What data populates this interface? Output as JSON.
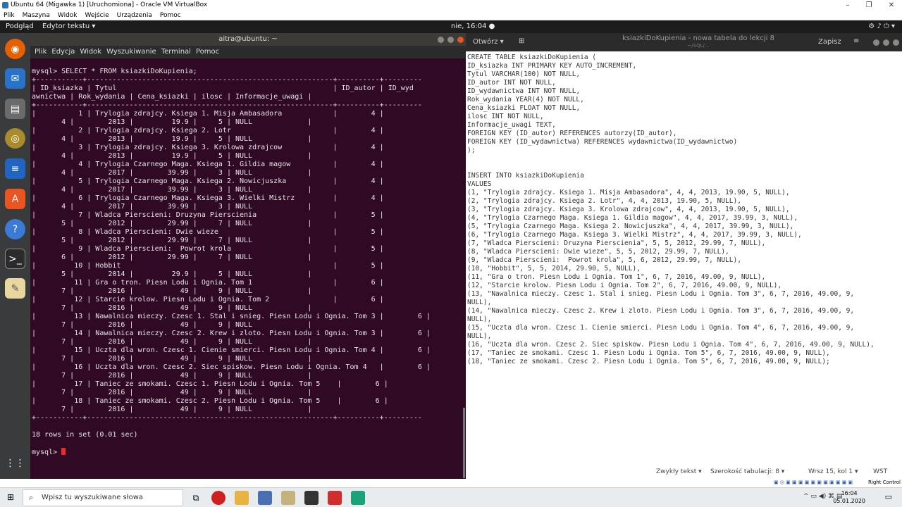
{
  "vbox": {
    "title": "Ubuntu 64 (Migawka 1) [Uruchomiona] - Oracle VM VirtualBox",
    "menu": [
      "Plik",
      "Maszyna",
      "Widok",
      "Wejście",
      "Urządzenia",
      "Pomoc"
    ],
    "status_right": "Right Control"
  },
  "gnome": {
    "activities": "Podgląd",
    "app": "Edytor tekstu ▾",
    "clock": "nie, 16:04 ●"
  },
  "terminal": {
    "title": "aitra@ubuntu: ~",
    "menu": [
      "Plik",
      "Edycja",
      "Widok",
      "Wyszukiwanie",
      "Terminal",
      "Pomoc"
    ],
    "lines": [
      "mysql> SELECT * FROM ksiazkiDoKupienia;",
      "+-----------+----------------------------------------------------------+----------+---------",
      "| ID_ksiazka | Tytul                                                   | ID_autor | ID_wyd",
      "awnictwa | Rok_wydania | Cena_ksiazki | ilosc | Informacje_uwagi |",
      "+-----------+----------------------------------------------------------+----------+---------",
      "|          1 | Trylogia zdrajcy. Ksiega 1. Misja Ambasadora            |        4 |",
      "       4 |        2013 |         19.9 |     5 | NULL             |",
      "|          2 | Trylogia zdrajcy. Ksiega 2. Lotr                        |        4 |",
      "       4 |        2013 |         19.9 |     5 | NULL             |",
      "|          3 | Trylogia zdrajcy. Ksiega 3. Krolowa zdrajcow            |        4 |",
      "       4 |        2013 |         19.9 |     5 | NULL             |",
      "|          4 | Trylogia Czarnego Maga. Ksiega 1. Gildia magow          |        4 |",
      "       4 |        2017 |        39.99 |     3 | NULL             |",
      "|          5 | Trylogia Czarnego Maga. Ksiega 2. Nowicjuszka           |        4 |",
      "       4 |        2017 |        39.99 |     3 | NULL             |",
      "|          6 | Trylogia Czarnego Maga. Ksiega 3. Wielki Mistrz         |        4 |",
      "       4 |        2017 |        39.99 |     3 | NULL             |",
      "|          7 | Wladca Pierscieni: Druzyna Pierscienia                  |        5 |",
      "       5 |        2012 |        29.99 |     7 | NULL             |",
      "|          8 | Wladca Pierscieni: Dwie wieze                           |        5 |",
      "       5 |        2012 |        29.99 |     7 | NULL             |",
      "|          9 | Wladca Pierscieni:  Powrot krola                        |        5 |",
      "       6 |        2012 |        29.99 |     7 | NULL             |",
      "|         10 | Hobbit                                                  |        5 |",
      "       5 |        2014 |         29.9 |     5 | NULL             |",
      "|         11 | Gra o tron. Piesn Lodu i Ognia. Tom 1                   |        6 |",
      "       7 |        2016 |           49 |     9 | NULL             |",
      "|         12 | Starcie krolow. Piesn Lodu i Ognia. Tom 2               |        6 |",
      "       7 |        2016 |           49 |     9 | NULL             |",
      "|         13 | Nawalnica mieczy. Czesc 1. Stal i snieg. Piesn Lodu i Ognia. Tom 3 |        6 |",
      "       7 |        2016 |           49 |     9 | NULL             |",
      "|         14 | Nawalnica mieczy. Czesc 2. Krew i zloto. Piesn Lodu i Ognia. Tom 3 |        6 |",
      "       7 |        2016 |           49 |     9 | NULL             |",
      "|         15 | Uczta dla wron. Czesc 1. Cienie smierci. Piesn Lodu i Ognia. Tom 4 |        6 |",
      "       7 |        2016 |           49 |     9 | NULL             |",
      "|         16 | Uczta dla wron. Czesc 2. Siec spiskow. Piesn Lodu i Ognia. Tom 4   |        6 |",
      "       7 |        2016 |           49 |     9 | NULL             |",
      "|         17 | Taniec ze smokami. Czesc 1. Piesn Lodu i Ognia. Tom 5    |        6 |",
      "       7 |        2016 |           49 |     9 | NULL             |",
      "|         18 | Taniec ze smokami. Czesc 2. Piesn Lodu i Ognia. Tom 5    |        6 |",
      "       7 |        2016 |           49 |     9 | NULL             |",
      "+-----------+----------------------------------------------------------+----------+---------",
      "",
      "18 rows in set (0.01 sec)",
      ""
    ],
    "prompt": "mysql> "
  },
  "gedit": {
    "open": "Otwórz ▾",
    "save": "Zapisz",
    "title": "ksiazkiDoKupienia - nowa tabela do lekcji 8",
    "subtitle": "~/SQL/...",
    "lines": [
      "CREATE TABLE ksiazkiDoKupienia (",
      "ID_ksiazka INT PRIMARY KEY AUTO_INCREMENT,",
      "Tytul VARCHAR(100) NOT NULL,",
      "ID_autor INT NOT NULL,",
      "ID_wydawnictwa INT NOT NULL,",
      "Rok_wydania YEAR(4) NOT NULL,",
      "Cena_ksiazki FLOAT NOT NULL,",
      "ilosc INT NOT NULL,",
      "Informacje_uwagi TEXT,",
      "FOREIGN KEY (ID_autor) REFERENCES autorzy(ID_autor),",
      "FOREIGN KEY (ID_wydawnictwa) REFERENCES wydawnictwa(ID_wydawnictwo)",
      ");",
      "",
      "",
      "INSERT INTO ksiazkiDoKupienia",
      "VALUES",
      "(1, \"Trylogia zdrajcy. Ksiega 1. Misja Ambasadora\", 4, 4, 2013, 19.90, 5, NULL),",
      "(2, \"Trylogia zdrajcy. Ksiega 2. Lotr\", 4, 4, 2013, 19.90, 5, NULL),",
      "(3, \"Trylogia zdrajcy. Ksiega 3. Krolowa zdrajcow\", 4, 4, 2013, 19.90, 5, NULL),",
      "(4, \"Trylogia Czarnego Maga. Ksiega 1. Gildia magow\", 4, 4, 2017, 39.99, 3, NULL),",
      "(5, \"Trylogia Czarnego Maga. Ksiega 2. Nowicjuszka\", 4, 4, 2017, 39.99, 3, NULL),",
      "(6, \"Trylogia Czarnego Maga. Ksiega 3. Wielki Mistrz\", 4, 4, 2017, 39.99, 3, NULL),",
      "(7, \"Wladca Pierscieni: Druzyna Pierscienia\", 5, 5, 2012, 29.99, 7, NULL),",
      "(8, \"Wladca Pierscieni: Dwie wieze\", 5, 5, 2012, 29.99, 7, NULL),",
      "(9, \"Wladca Pierscieni:  Powrot krola\", 5, 6, 2012, 29.99, 7, NULL),",
      "(10, \"Hobbit\", 5, 5, 2014, 29.90, 5, NULL),",
      "(11, \"Gra o tron. Piesn Lodu i Ognia. Tom 1\", 6, 7, 2016, 49.00, 9, NULL),",
      "(12, \"Starcie krolow. Piesn Lodu i Ognia. Tom 2\", 6, 7, 2016, 49.00, 9, NULL),",
      "(13, \"Nawalnica mieczy. Czesc 1. Stal i snieg. Piesn Lodu i Ognia. Tom 3\", 6, 7, 2016, 49.00, 9,",
      "NULL),",
      "(14, \"Nawalnica mieczy. Czesc 2. Krew i zloto. Piesn Lodu i Ognia. Tom 3\", 6, 7, 2016, 49.00, 9,",
      "NULL),",
      "(15, \"Uczta dla wron. Czesc 1. Cienie smierci. Piesn Lodu i Ognia. Tom 4\", 6, 7, 2016, 49.00, 9,",
      "NULL),",
      "(16, \"Uczta dla wron. Czesc 2. Siec spiskow. Piesn Lodu i Ognia. Tom 4\", 6, 7, 2016, 49.00, 9, NULL),",
      "(17, \"Taniec ze smokami. Czesc 1. Piesn Lodu i Ognia. Tom 5\", 6, 7, 2016, 49.00, 9, NULL),",
      "(18, \"Taniec ze smokami. Czesc 2. Piesn Lodu i Ognia. Tom 5\", 6, 7, 2016, 49.00, 9, NULL);"
    ],
    "status": {
      "mode": "Zwykły tekst ▾",
      "tab": "Szerokość tabulacji: 8 ▾",
      "pos": "Wrsz 15, kol 1 ▾",
      "ins": "WST"
    }
  },
  "taskbar": {
    "search_placeholder": "Wpisz tu wyszukiwane słowa",
    "time": "16:04",
    "date": "05.01.2020"
  }
}
